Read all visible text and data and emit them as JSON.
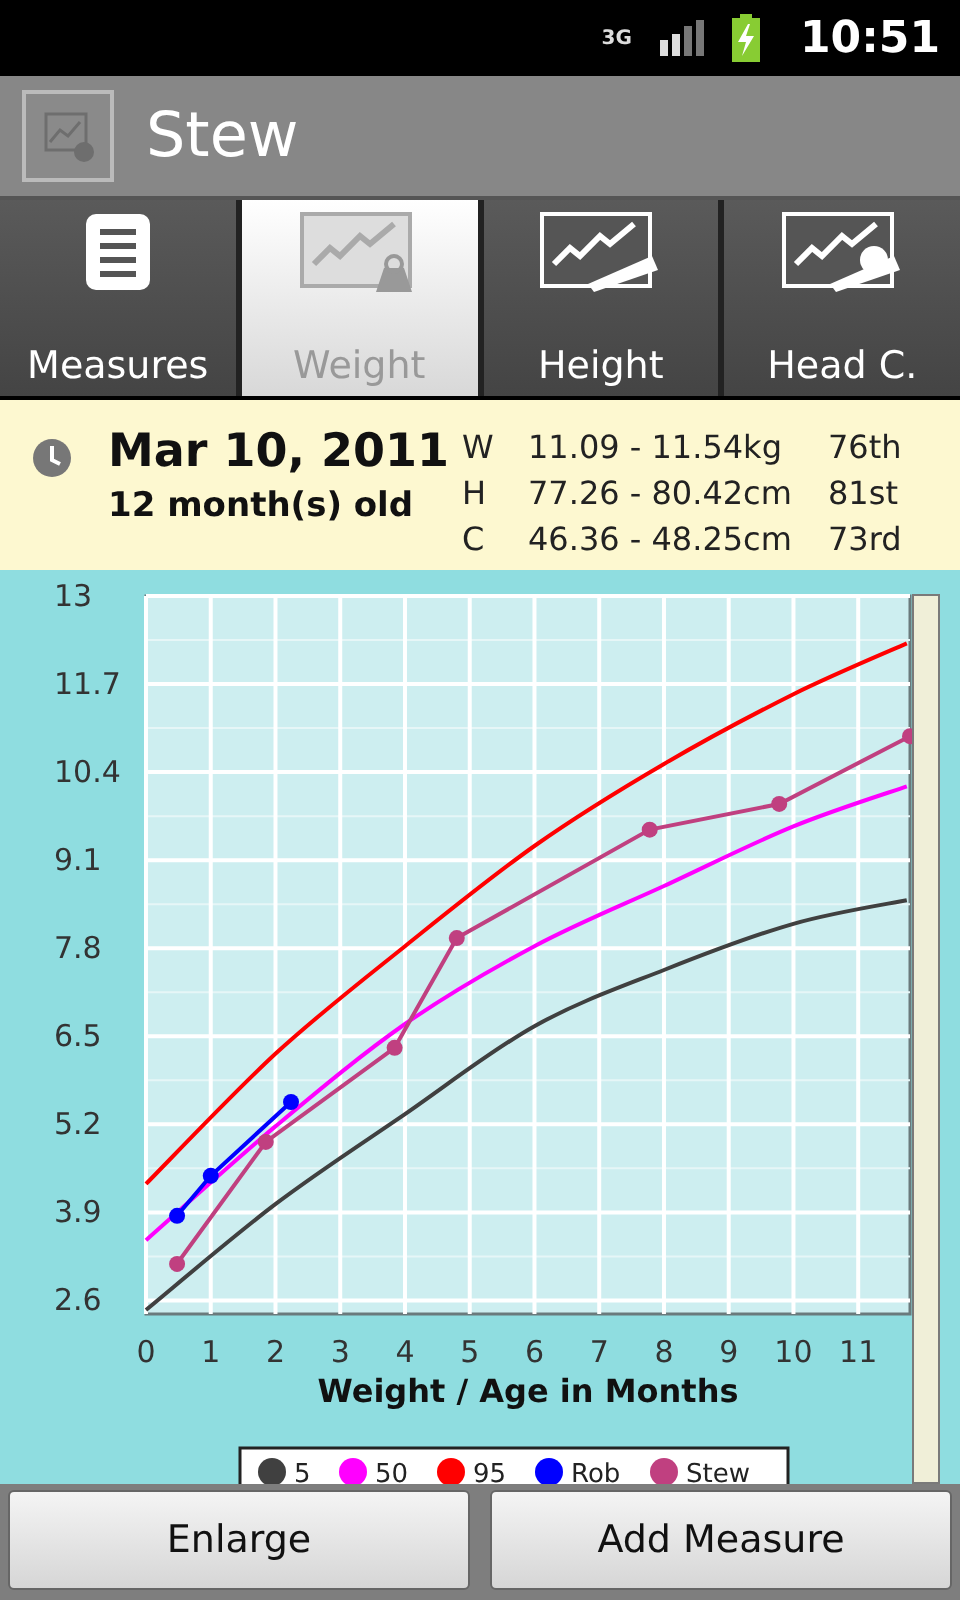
{
  "status_bar": {
    "network": "3G",
    "time": "10:51"
  },
  "title_bar": {
    "title": "Stew"
  },
  "tabs": [
    {
      "label": "Measures",
      "kind": "list",
      "selected": false
    },
    {
      "label": "Weight",
      "kind": "weight",
      "selected": true
    },
    {
      "label": "Height",
      "kind": "height",
      "selected": false
    },
    {
      "label": "Head C.",
      "kind": "head",
      "selected": false
    }
  ],
  "info": {
    "date": "Mar 10, 2011",
    "age": "12 month(s) old",
    "rows": [
      {
        "letter": "W",
        "range": "11.09 - 11.54kg",
        "percentile": "76th"
      },
      {
        "letter": "H",
        "range": "77.26 - 80.42cm",
        "percentile": "81st"
      },
      {
        "letter": "C",
        "range": "46.36 - 48.25cm",
        "percentile": "73rd"
      }
    ]
  },
  "chart": {
    "chart_data": {
      "type": "line",
      "xlabel": "Weight / Age in Months",
      "xlim": [
        0,
        11.8
      ],
      "ylim": [
        2.4,
        13
      ],
      "grid": true,
      "legend": "bottom",
      "xticks": [
        0,
        1,
        2,
        3,
        4,
        5,
        6,
        7,
        8,
        9,
        10,
        11
      ],
      "yticks": [
        2.6,
        3.9,
        5.2,
        6.5,
        7.8,
        9.1,
        10.4,
        11.7,
        13
      ],
      "series": [
        {
          "name": "5",
          "color": "#404040",
          "marker": "none",
          "x": [
            0,
            2,
            4,
            6,
            8,
            10,
            11.75
          ],
          "values": [
            2.46,
            4.02,
            5.35,
            6.65,
            7.48,
            8.16,
            8.51
          ]
        },
        {
          "name": "50",
          "color": "#ff00ff",
          "marker": "none",
          "x": [
            0,
            2,
            4,
            6,
            8,
            10,
            11.75
          ],
          "values": [
            3.49,
            5.17,
            6.68,
            7.83,
            8.72,
            9.6,
            10.19
          ]
        },
        {
          "name": "95",
          "color": "#ff0000",
          "marker": "none",
          "x": [
            0,
            2,
            4,
            6,
            8,
            10,
            11.75
          ],
          "values": [
            4.32,
            6.24,
            7.83,
            9.31,
            10.52,
            11.55,
            12.3
          ]
        },
        {
          "name": "Rob",
          "color": "#0000ff",
          "marker": "circle",
          "x": [
            0.48,
            1.0,
            2.24
          ],
          "values": [
            3.85,
            4.44,
            5.53
          ]
        },
        {
          "name": "Stew",
          "color": "#c04080",
          "marker": "circle",
          "x": [
            0.48,
            1.85,
            3.84,
            4.8,
            7.78,
            9.78,
            11.8
          ],
          "values": [
            3.14,
            4.94,
            6.33,
            7.95,
            9.55,
            9.93,
            10.93
          ]
        }
      ]
    }
  },
  "buttons": [
    {
      "label": "Enlarge"
    },
    {
      "label": "Add Measure"
    }
  ]
}
